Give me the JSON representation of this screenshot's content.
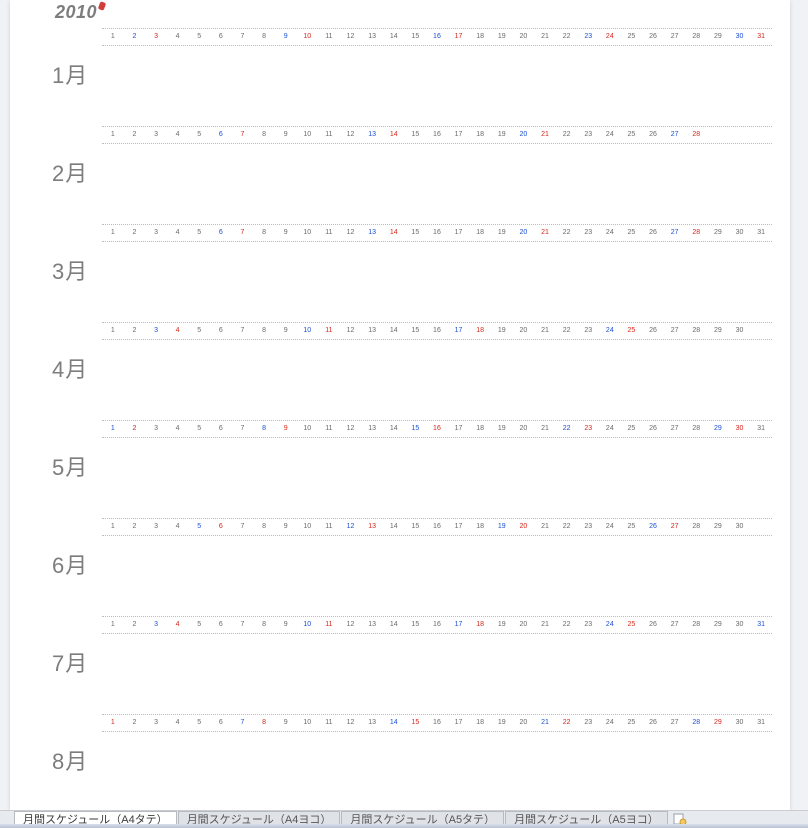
{
  "year": "2010",
  "month_suffix": "月",
  "months": [
    {
      "label": "1月",
      "days_in_month": 31,
      "first_weekday": 5
    },
    {
      "label": "2月",
      "days_in_month": 28,
      "first_weekday": 1
    },
    {
      "label": "3月",
      "days_in_month": 31,
      "first_weekday": 1
    },
    {
      "label": "4月",
      "days_in_month": 30,
      "first_weekday": 4
    },
    {
      "label": "5月",
      "days_in_month": 31,
      "first_weekday": 6
    },
    {
      "label": "6月",
      "days_in_month": 30,
      "first_weekday": 2
    },
    {
      "label": "7月",
      "days_in_month": 31,
      "first_weekday": 4
    },
    {
      "label": "8月",
      "days_in_month": 31,
      "first_weekday": 0
    }
  ],
  "tabs": [
    {
      "label": "月間スケジュール（A4タテ）",
      "active": true
    },
    {
      "label": "月間スケジュール（A4ヨコ）",
      "active": false
    },
    {
      "label": "月間スケジュール（A5タテ）",
      "active": false
    },
    {
      "label": "月間スケジュール（A5ヨコ）",
      "active": false
    }
  ]
}
